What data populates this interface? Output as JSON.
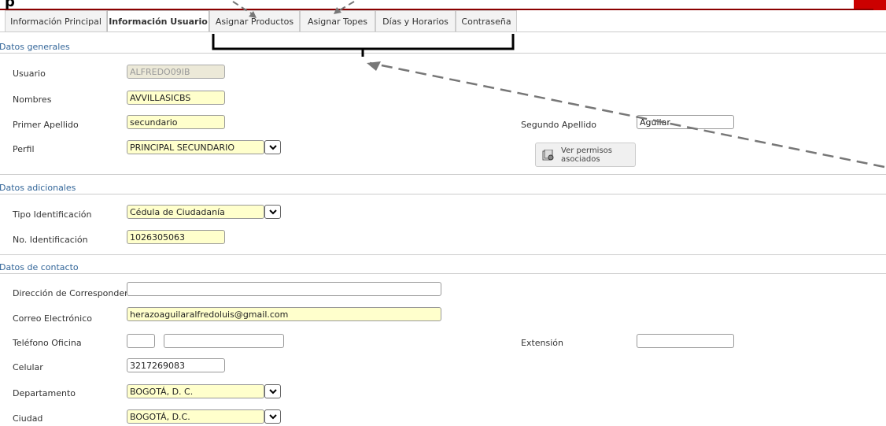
{
  "header": {
    "top_text": "p"
  },
  "tabs": [
    {
      "label": "Información Principal"
    },
    {
      "label": "Información Usuario"
    },
    {
      "label": "Asignar Productos"
    },
    {
      "label": "Asignar Topes"
    },
    {
      "label": "Días y Horarios"
    },
    {
      "label": "Contraseña"
    }
  ],
  "sections": {
    "general": "Datos generales",
    "additional": "Datos adicionales",
    "contact": "Datos de contacto"
  },
  "fields": {
    "usuario": {
      "label": "Usuario",
      "value": "ALFREDO09IB"
    },
    "nombres": {
      "label": "Nombres",
      "value": "AVVILLASICBS"
    },
    "primer_apellido": {
      "label": "Primer Apellido",
      "value": "secundario"
    },
    "segundo_apellido": {
      "label": "Segundo Apellido",
      "value": "Aguilar"
    },
    "perfil": {
      "label": "Perfil",
      "value": "PRINCIPAL SECUNDARIO"
    },
    "ver_permisos": {
      "label": "Ver permisos asociados"
    },
    "tipo_identificacion": {
      "label": "Tipo Identificación",
      "value": "Cédula de Ciudadanía"
    },
    "no_identificacion": {
      "label": "No. Identificación",
      "value": "1026305063"
    },
    "direccion": {
      "label": "Dirección de Correspondencia",
      "value": ""
    },
    "correo": {
      "label": "Correo Electrónico",
      "value": "herazoaguilaralfredoluis@gmail.com"
    },
    "telefono_oficina": {
      "label": "Teléfono Oficina",
      "value_a": "",
      "value_b": ""
    },
    "extension": {
      "label": "Extensión",
      "value": ""
    },
    "celular": {
      "label": "Celular",
      "value": "3217269083"
    },
    "departamento": {
      "label": "Departamento",
      "value": "BOGOTÁ, D. C."
    },
    "ciudad": {
      "label": "Ciudad",
      "value": "BOGOTÁ, D.C."
    }
  },
  "colors": {
    "section_title": "#336699",
    "required_field": "#ffffcc",
    "accent_red": "#cc0000"
  }
}
